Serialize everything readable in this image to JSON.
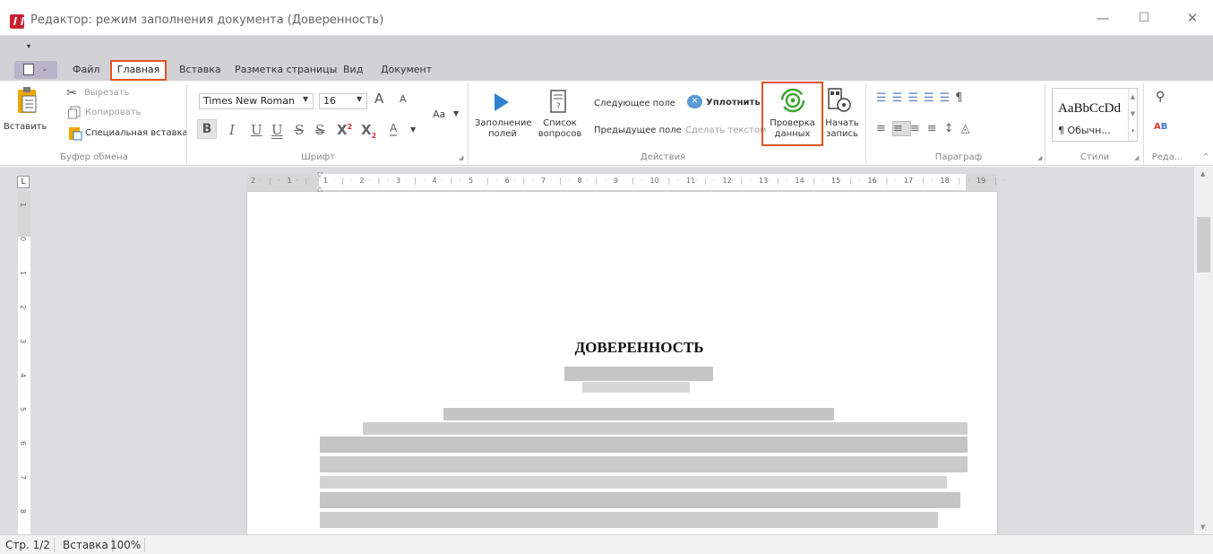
{
  "window": {
    "title": "Редактор: режим заполнения документа (Доверенность)",
    "min": "—",
    "max": "☐",
    "close": "✕"
  },
  "quick_access": {
    "arrow": "▾"
  },
  "tabs": [
    "Файл",
    "Главная",
    "Вставка",
    "Разметка страницы",
    "Вид",
    "Документ"
  ],
  "active_tab": "Главная",
  "clipboard": {
    "paste": "Вставить",
    "cut": "Вырезать",
    "copy": "Копировать",
    "special_paste": "Специальная вставка",
    "group": "Буфер обмена"
  },
  "font": {
    "family": "Times New Roman",
    "size": "16",
    "grow": "A",
    "shrink": "A",
    "case": "Aa",
    "bold": "B",
    "italic": "I",
    "underline": "U",
    "double_underline": "U",
    "strike": "S",
    "double_strike": "S",
    "superscript": "X",
    "subscript": "X",
    "color": "A",
    "group": "Шрифт"
  },
  "actions": {
    "fill_fields": "Заполнение полей",
    "question_list": "Список вопросов",
    "next_field": "Следующее поле",
    "prev_field": "Предыдущее поле",
    "compact": "Уплотнить",
    "make_text": "Сделать текстом",
    "check_data": "Проверка данных",
    "start_record": "Начать запись",
    "group": "Действия"
  },
  "paragraph": {
    "group": "Параграф"
  },
  "styles": {
    "preview": "AaBbCcDd",
    "normal": "¶ Обычн...",
    "group": "Стили"
  },
  "editing": {
    "group": "Реда..."
  },
  "ruler": {
    "corner": "L",
    "h_numbers": [
      "2",
      "1",
      "1",
      "2",
      "3",
      "4",
      "5",
      "6",
      "7",
      "8",
      "9",
      "10",
      "11",
      "12",
      "13",
      "14",
      "15",
      "16",
      "17",
      "18",
      "19"
    ],
    "v_numbers": [
      "1",
      "0",
      "1",
      "2",
      "3",
      "4",
      "5",
      "6",
      "7",
      "8"
    ]
  },
  "document": {
    "heading": "ДОВЕРЕННОСТЬ"
  },
  "status": {
    "page": "Стр. 1/2",
    "mode": "Вставка",
    "zoom": "100%"
  },
  "colors": {
    "accent_highlight": "#e0541f",
    "ribbon_bg": "#d1d1d6",
    "play_blue": "#2f7fd0",
    "check_green": "#3fa535"
  }
}
